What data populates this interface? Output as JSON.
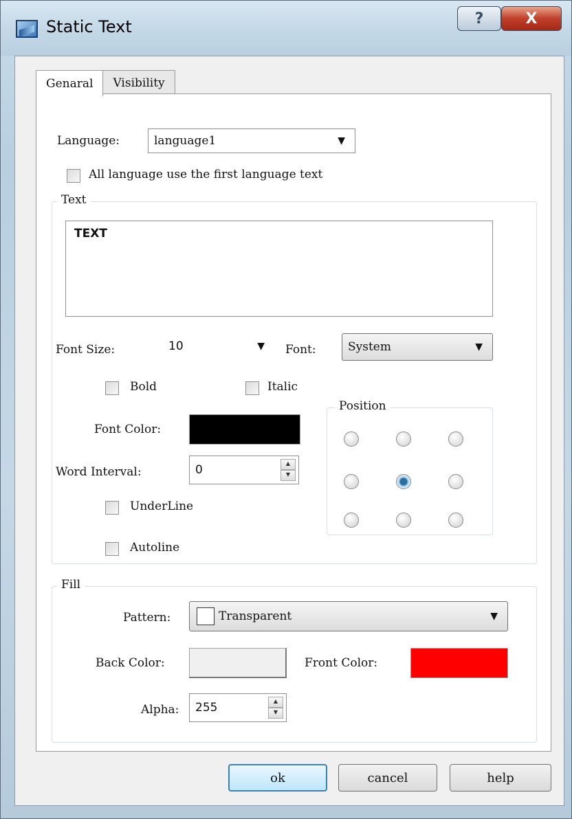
{
  "window": {
    "title": "Static Text",
    "help_glyph": "?",
    "close_glyph": "X"
  },
  "tabs": [
    {
      "label": "Genaral",
      "active": true
    },
    {
      "label": "Visibility",
      "active": false
    }
  ],
  "language": {
    "label": "Language:",
    "value": "language1",
    "all_language_checkbox": "All language use the first language text",
    "all_language_checked": false
  },
  "text_group": {
    "legend": "Text",
    "text_value": "TEXT",
    "font_size_label": "Font Size:",
    "font_size_value": "10",
    "font_label": "Font:",
    "font_value": "System",
    "bold_label": "Bold",
    "italic_label": "Italic",
    "font_color_label": "Font Color:",
    "font_color": "#000000",
    "word_interval_label": "Word Interval:",
    "word_interval_value": "0",
    "underline_label": "UnderLine",
    "autoline_label": "Autoline",
    "position_legend": "Position",
    "position_selected": "center"
  },
  "fill_group": {
    "legend": "Fill",
    "pattern_label": "Pattern:",
    "pattern_value": "Transparent",
    "back_color_label": "Back Color:",
    "back_color": "#f0f0f0",
    "front_color_label": "Front Color:",
    "front_color": "#ff0000",
    "alpha_label": "Alpha:",
    "alpha_value": "255"
  },
  "buttons": {
    "ok": "ok",
    "cancel": "cancel",
    "help": "help"
  },
  "icons": {
    "dropdown": "▼",
    "spin_up": "▲",
    "spin_down": "▼"
  }
}
